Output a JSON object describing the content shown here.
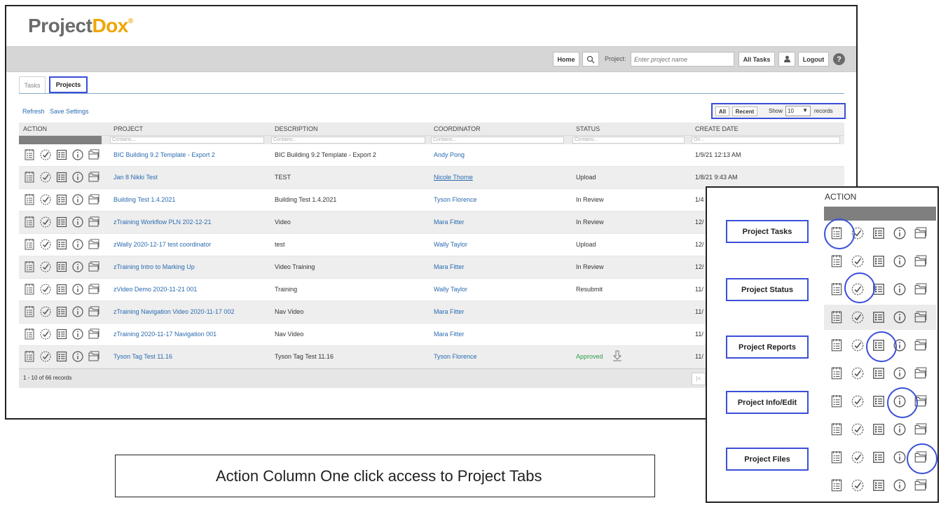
{
  "app": {
    "logo_main": "Project",
    "logo_accent": "Dox",
    "logo_mark": "®"
  },
  "topbar": {
    "home": "Home",
    "project_label": "Project:",
    "project_placeholder": "Enter project name",
    "all_tasks": "All Tasks",
    "logout": "Logout",
    "help": "?"
  },
  "tabs": [
    {
      "label": "Tasks",
      "active": false
    },
    {
      "label": "Projects",
      "active": true
    }
  ],
  "toolbar": {
    "refresh": "Refresh",
    "save_settings": "Save Settings",
    "all": "All",
    "recent": "Recent",
    "show": "Show",
    "show_value": "10",
    "records": "records"
  },
  "grid": {
    "columns": [
      "ACTION",
      "PROJECT",
      "DESCRIPTION",
      "COORDINATOR",
      "STATUS",
      "CREATE DATE"
    ],
    "filter_placeholder": "Contains...",
    "date_filter_placeholder": "On...",
    "rows": [
      {
        "project": "BIC Building 9.2 Template - Export 2",
        "description": "BIC Building 9.2 Template - Export 2",
        "coordinator": "Andy Pong",
        "status": "",
        "date": "1/9/21 12:13 AM"
      },
      {
        "project": "Jan 8 Nikki Test",
        "description": "TEST",
        "coordinator": "Nicole Thorne",
        "status": "Upload",
        "date": "1/8/21 9:43 AM"
      },
      {
        "project": "Building Test 1.4.2021",
        "description": "Building Test 1.4.2021",
        "coordinator": "Tyson Florence",
        "status": "In Review",
        "date": "1/4"
      },
      {
        "project": "zTraining Workflow PLN 202-12-21",
        "description": "Video",
        "coordinator": "Mara Fitter",
        "status": "In Review",
        "date": "12/"
      },
      {
        "project": "zWally 2020-12-17 test coordinator",
        "description": "test",
        "coordinator": "Wally Taylor",
        "status": "Upload",
        "date": "12/"
      },
      {
        "project": "zTraining Intro to Marking Up",
        "description": "Video Training",
        "coordinator": "Mara Fitter",
        "status": "In Review",
        "date": "12/"
      },
      {
        "project": "zVideo Demo 2020-11-21 001",
        "description": "Training",
        "coordinator": "Wally Taylor",
        "status": "Resubmit",
        "date": "11/"
      },
      {
        "project": "zTraining Navigation Video 2020-11-17 002",
        "description": "Nav Video",
        "coordinator": "Mara Fitter",
        "status": "",
        "date": "11/"
      },
      {
        "project": "zTraining 2020-11-17 Navigation 001",
        "description": "Nav Video",
        "coordinator": "Mara Fitter",
        "status": "",
        "date": "11/"
      },
      {
        "project": "Tyson Tag Test 11.16",
        "description": "Tyson Tag Test 11.16",
        "coordinator": "Tyson Florence",
        "status": "Approved",
        "date": "11/"
      }
    ],
    "footer": "1 - 10 of 66 records",
    "footer_nav": "|<"
  },
  "caption": "Action Column One click access to Project Tabs",
  "inset": {
    "header": "ACTION",
    "labels": [
      "Project Tasks",
      "Project Status",
      "Project Reports",
      "Project Info/Edit",
      "Project Files"
    ]
  },
  "icons": [
    "tasks-icon",
    "status-check-icon",
    "reports-list-icon",
    "info-icon",
    "files-folder-icon"
  ],
  "colors": {
    "highlight": "#3a4fd8",
    "link": "#2a6bb0",
    "logo_accent": "#f0a500",
    "status_approved": "#2a9d4a"
  }
}
